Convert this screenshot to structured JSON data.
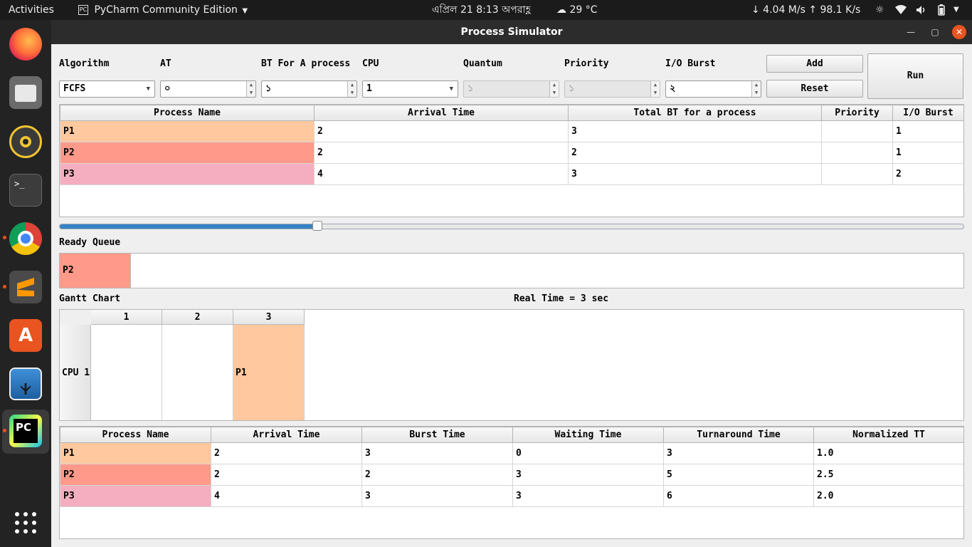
{
  "topbar": {
    "activities": "Activities",
    "app_name": "PyCharm Community Edition",
    "datetime": "এপ্রিল 21  8:13 অপরাহ্ণ",
    "weather": "29 °C",
    "network": "↓ 4.04 M/s ↑ 98.1 K/s"
  },
  "dock": {
    "apps": [
      "firefox-icon",
      "files-icon",
      "rhythmbox-icon",
      "terminal-icon",
      "chrome-icon",
      "sublime-text-icon",
      "software-center-icon",
      "shotwell-icon",
      "pycharm-icon",
      "app-grid-icon"
    ]
  },
  "window": {
    "title": "Process Simulator"
  },
  "controls": {
    "algorithm_label": "Algorithm",
    "algorithm_value": "FCFS",
    "at_label": "AT",
    "at_value": "০",
    "bt_label": "BT For A process",
    "bt_value": "১",
    "cpu_label": "CPU",
    "cpu_value": "1",
    "quantum_label": "Quantum",
    "quantum_value": "১",
    "priority_label": "Priority",
    "priority_value": "১",
    "io_label": "I/O Burst",
    "io_value": "২",
    "add_label": "Add",
    "reset_label": "Reset",
    "run_label": "Run"
  },
  "process_table": {
    "headers": [
      "Process Name",
      "Arrival Time",
      "Total BT for a process",
      "Priority",
      "I/O Burst"
    ],
    "rows": [
      [
        "P1",
        "2",
        "3",
        "",
        "1"
      ],
      [
        "P2",
        "2",
        "2",
        "",
        "1"
      ],
      [
        "P3",
        "4",
        "3",
        "",
        "2"
      ]
    ]
  },
  "slider": {
    "value": 0.285
  },
  "ready_queue": {
    "label": "Ready Queue",
    "items": [
      "P2"
    ]
  },
  "gantt": {
    "label": "Gantt Chart",
    "real_time": "Real Time = 3 sec",
    "time_headers": [
      "1",
      "2",
      "3"
    ],
    "row_label": "CPU 1",
    "cells": [
      "",
      "",
      "P1"
    ]
  },
  "result_table": {
    "headers": [
      "Process Name",
      "Arrival Time",
      "Burst Time",
      "Waiting Time",
      "Turnaround Time",
      "Normalized TT"
    ],
    "rows": [
      [
        "P1",
        "2",
        "3",
        "0",
        "3",
        "1.0"
      ],
      [
        "P2",
        "2",
        "2",
        "3",
        "5",
        "2.5"
      ],
      [
        "P3",
        "4",
        "3",
        "3",
        "6",
        "2.0"
      ]
    ]
  },
  "colors": {
    "P1": "#ffc89f",
    "P2": "#ff9a8a",
    "P3": "#f5aebf",
    "slider_fill": "#3584c4"
  }
}
